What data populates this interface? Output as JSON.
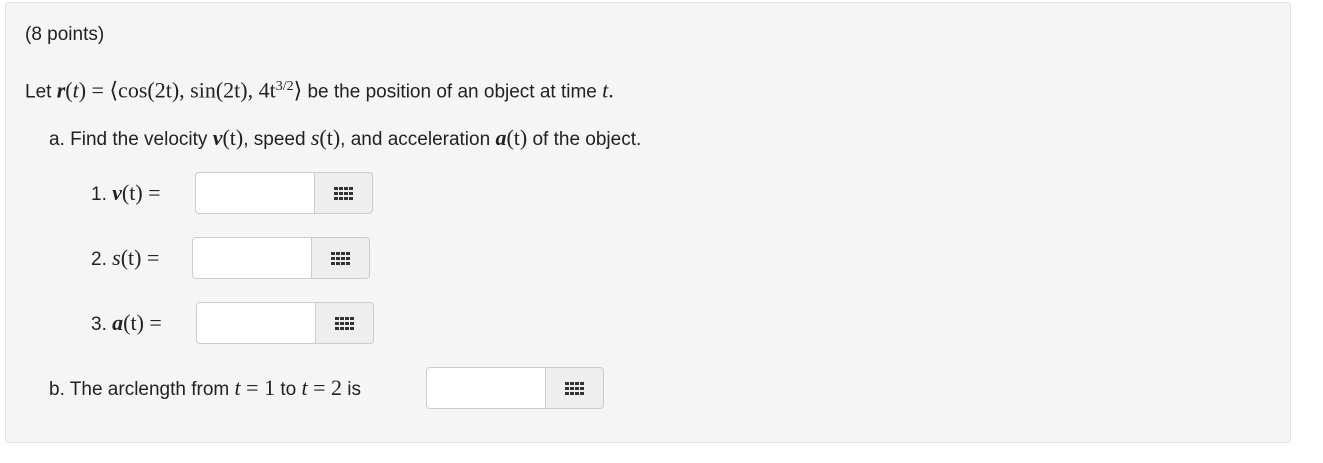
{
  "problem": {
    "points_label": "(8 points)",
    "intro": {
      "prefix": "Let ",
      "r": "r",
      "t_open": "(",
      "t_var": "t",
      "t_close": ")",
      "equals": " = ",
      "vector": "⟨cos(2t), sin(2t), 4t",
      "exponent": "3/2",
      "vector_close": "⟩",
      "suffix": " be the position of an object at time ",
      "t_final": "t",
      "period": "."
    },
    "part_a": {
      "text_1": "a. Find the velocity ",
      "v": "v",
      "vt": "(t)",
      "text_2": ", speed ",
      "s": "s",
      "st": "(t)",
      "text_3": ", and acceleration ",
      "a": "a",
      "at": "(t)",
      "text_4": " of the object.",
      "items": [
        {
          "num": "1. ",
          "sym": "v",
          "arg": "(t)",
          "eq": " ="
        },
        {
          "num": "2. ",
          "sym": "s",
          "arg": "(t)",
          "eq": " ="
        },
        {
          "num": "3. ",
          "sym": "a",
          "arg": "(t)",
          "eq": " ="
        }
      ]
    },
    "part_b": {
      "text_1": "b. The arclength from ",
      "t1": "t",
      "eq1": " = 1",
      "to": " to ",
      "t2": "t",
      "eq2": " = 2",
      "text_2": " is"
    },
    "icon": "equation-editor-grid-icon"
  }
}
